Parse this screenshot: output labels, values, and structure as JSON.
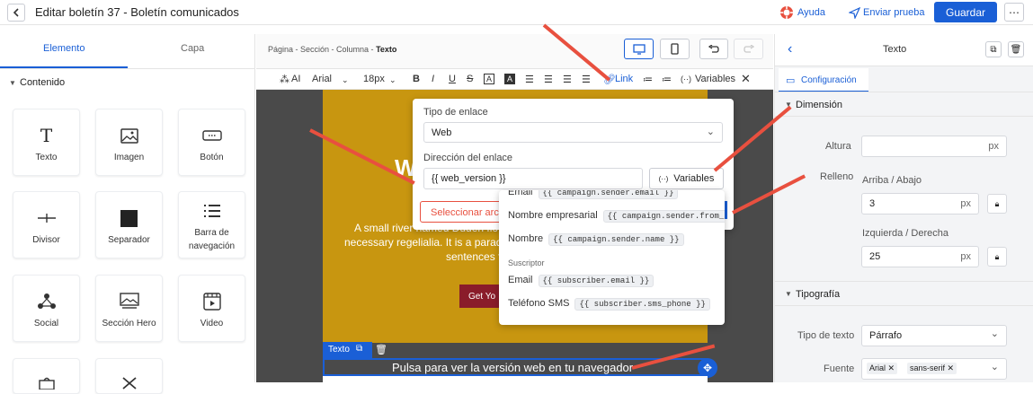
{
  "header": {
    "title": "Editar boletín 37 - Boletín comunicados",
    "help": "Ayuda",
    "send_test": "Enviar prueba",
    "save": "Guardar"
  },
  "left": {
    "tabs": [
      "Elemento",
      "Capa"
    ],
    "section": "Contenido",
    "blocks": [
      {
        "label": "Texto",
        "icon": "text-icon"
      },
      {
        "label": "Imagen",
        "icon": "image-icon"
      },
      {
        "label": "Botón",
        "icon": "button-icon"
      },
      {
        "label": "Divisor",
        "icon": "divider-icon"
      },
      {
        "label": "Separador",
        "icon": "spacer-icon"
      },
      {
        "label": "Barra de navegación",
        "icon": "navbar-icon"
      },
      {
        "label": "Social",
        "icon": "social-icon"
      },
      {
        "label": "Sección Hero",
        "icon": "hero-icon"
      },
      {
        "label": "Video",
        "icon": "video-icon"
      }
    ]
  },
  "canvas": {
    "breadcrumb_path": "Página - Sección - Columna - ",
    "breadcrumb_current": "Texto",
    "toolbar": {
      "ai": "AI",
      "font": "Arial",
      "size": "18px",
      "link": "Link",
      "variables": "Variables"
    },
    "body_text_1": "A small river named Duden flows",
    "body_text_2": "necessary regelialia. It is a paradis",
    "body_text_3": "sentences f",
    "heading_partial": "W",
    "cta_partial": "Get Yo",
    "selected_label": "Texto",
    "selected_text": "Pulsa para ver la versión web en tu navegador"
  },
  "link_popup": {
    "type_label": "Tipo de enlace",
    "type_value": "Web",
    "address_label": "Dirección del enlace",
    "address_value": "{{ web_version }}",
    "variables_button": "Variables",
    "select_file": "Seleccionar arch"
  },
  "variables_dropdown": {
    "top_partial": {
      "label": "Email",
      "tag": "{{ campaign.sender.email }}"
    },
    "rows": [
      {
        "label": "Nombre empresarial",
        "tag": "{{ campaign.sender.from_name }}"
      },
      {
        "label": "Nombre",
        "tag": "{{ campaign.sender.name }}"
      }
    ],
    "group": "Suscriptor",
    "sub_rows": [
      {
        "label": "Email",
        "tag": "{{ subscriber.email }}"
      },
      {
        "label": "Teléfono SMS",
        "tag": "{{ subscriber.sms_phone }}"
      }
    ]
  },
  "right": {
    "title": "Texto",
    "tab": "Configuración",
    "dimension": "Dimensión",
    "height_label": "Altura",
    "height_value": "",
    "unit": "px",
    "padding_label": "Relleno",
    "top_bottom_label": "Arriba / Abajo",
    "top_bottom_value": "3",
    "left_right_label": "Izquierda / Derecha",
    "left_right_value": "25",
    "typography": "Tipografía",
    "text_type_label": "Tipo de texto",
    "text_type_value": "Párrafo",
    "font_label": "Fuente",
    "font_chips": [
      "Arial",
      "sans-serif"
    ]
  },
  "colors": {
    "accent": "#1a5fd6",
    "hero_bg": "#c89610",
    "annotation": "#e8503f"
  }
}
